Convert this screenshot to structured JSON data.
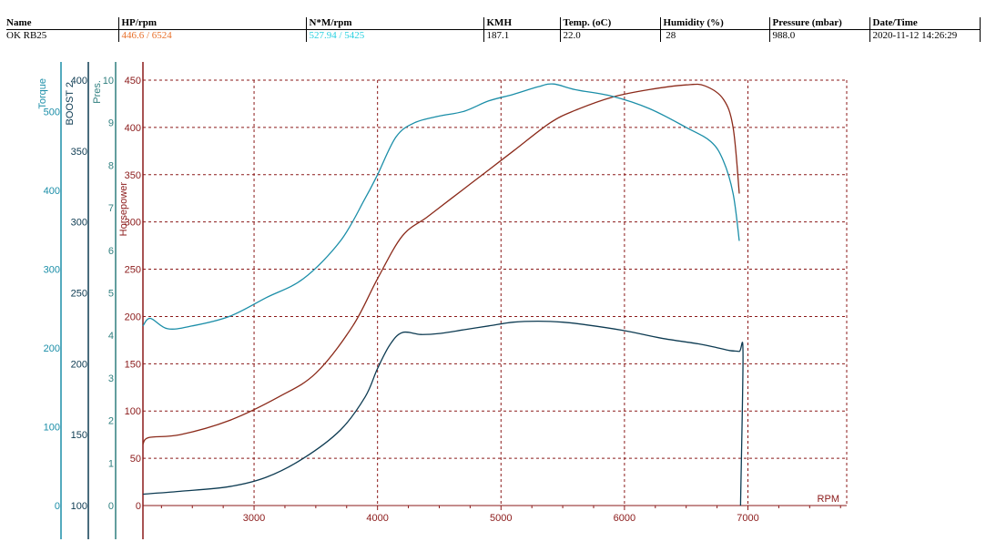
{
  "header": {
    "columns": [
      "Name",
      "HP/rpm",
      "N*M/rpm",
      "KMH",
      "Temp. (oC)",
      "Humidity (%)",
      "Pressure (mbar)",
      "Date/Time"
    ],
    "values": [
      "OK RB25",
      "446.6 / 6524",
      "527.94 / 5425",
      "187.1",
      "22.0",
      " 28",
      "988.0",
      "2020-11-12 14:26:29"
    ]
  },
  "colors": {
    "hp": "#8b2a1a",
    "torque": "#1b8ea8",
    "boost": "#0d3b52",
    "pres": "#2f7f7f",
    "grid": "#8b1a1a",
    "rpm_axis": "#8b1a1a",
    "hp_value_text": "#e8702a",
    "torque_value_text": "#28d0e0"
  },
  "chart_data": {
    "type": "line",
    "xlabel": "RPM",
    "xlim": [
      2100,
      7800
    ],
    "x_ticks": [
      3000,
      4000,
      5000,
      6000,
      7000
    ],
    "axes": {
      "horsepower": {
        "label": "Horsepower",
        "range": [
          0,
          450
        ],
        "ticks": [
          0,
          50,
          100,
          150,
          200,
          250,
          300,
          350,
          400,
          450
        ]
      },
      "pres": {
        "label": "Pres.",
        "range": [
          0,
          10
        ],
        "ticks": [
          0,
          1,
          2,
          3,
          4,
          5,
          6,
          7,
          8,
          9,
          10
        ]
      },
      "boost": {
        "label": "BOOST 2",
        "range": [
          100,
          400
        ],
        "ticks": [
          100,
          150,
          200,
          250,
          300,
          350,
          400
        ]
      },
      "torque": {
        "label": "Torque",
        "range": [
          0,
          540
        ],
        "ticks": [
          0,
          100,
          200,
          300,
          400,
          500
        ]
      }
    },
    "series": [
      {
        "key": "hp",
        "axis": "horsepower",
        "x": [
          2100,
          2150,
          2400,
          2800,
          3200,
          3500,
          3800,
          4000,
          4200,
          4400,
          4600,
          4900,
          5100,
          5400,
          5600,
          5900,
          6200,
          6500,
          6650,
          6800,
          6880,
          6930
        ],
        "y": [
          65,
          72,
          75,
          90,
          115,
          140,
          190,
          240,
          285,
          305,
          325,
          355,
          375,
          405,
          418,
          432,
          440,
          445,
          444,
          430,
          400,
          330
        ]
      },
      {
        "key": "torque",
        "axis": "horsepower",
        "x": [
          2100,
          2160,
          2300,
          2500,
          2800,
          3100,
          3400,
          3700,
          3900,
          4000,
          4150,
          4300,
          4500,
          4700,
          4900,
          5100,
          5300,
          5425,
          5600,
          5900,
          6200,
          6500,
          6700,
          6800,
          6880,
          6930
        ],
        "y": [
          190,
          198,
          187,
          190,
          200,
          220,
          240,
          280,
          325,
          350,
          390,
          405,
          412,
          417,
          428,
          435,
          443,
          446,
          440,
          433,
          420,
          400,
          385,
          365,
          330,
          280
        ]
      },
      {
        "key": "boost",
        "axis": "horsepower",
        "x": [
          2100,
          2400,
          2800,
          3100,
          3400,
          3700,
          3900,
          4000,
          4100,
          4200,
          4350,
          4500,
          4700,
          4900,
          5100,
          5300,
          5500,
          5700,
          6000,
          6300,
          6600,
          6750,
          6850,
          6930,
          6960,
          6940
        ],
        "y": [
          12,
          15,
          20,
          30,
          50,
          80,
          115,
          145,
          170,
          183,
          181,
          182,
          186,
          190,
          194,
          195,
          194,
          191,
          185,
          177,
          171,
          167,
          164,
          163,
          160,
          0
        ]
      }
    ]
  }
}
